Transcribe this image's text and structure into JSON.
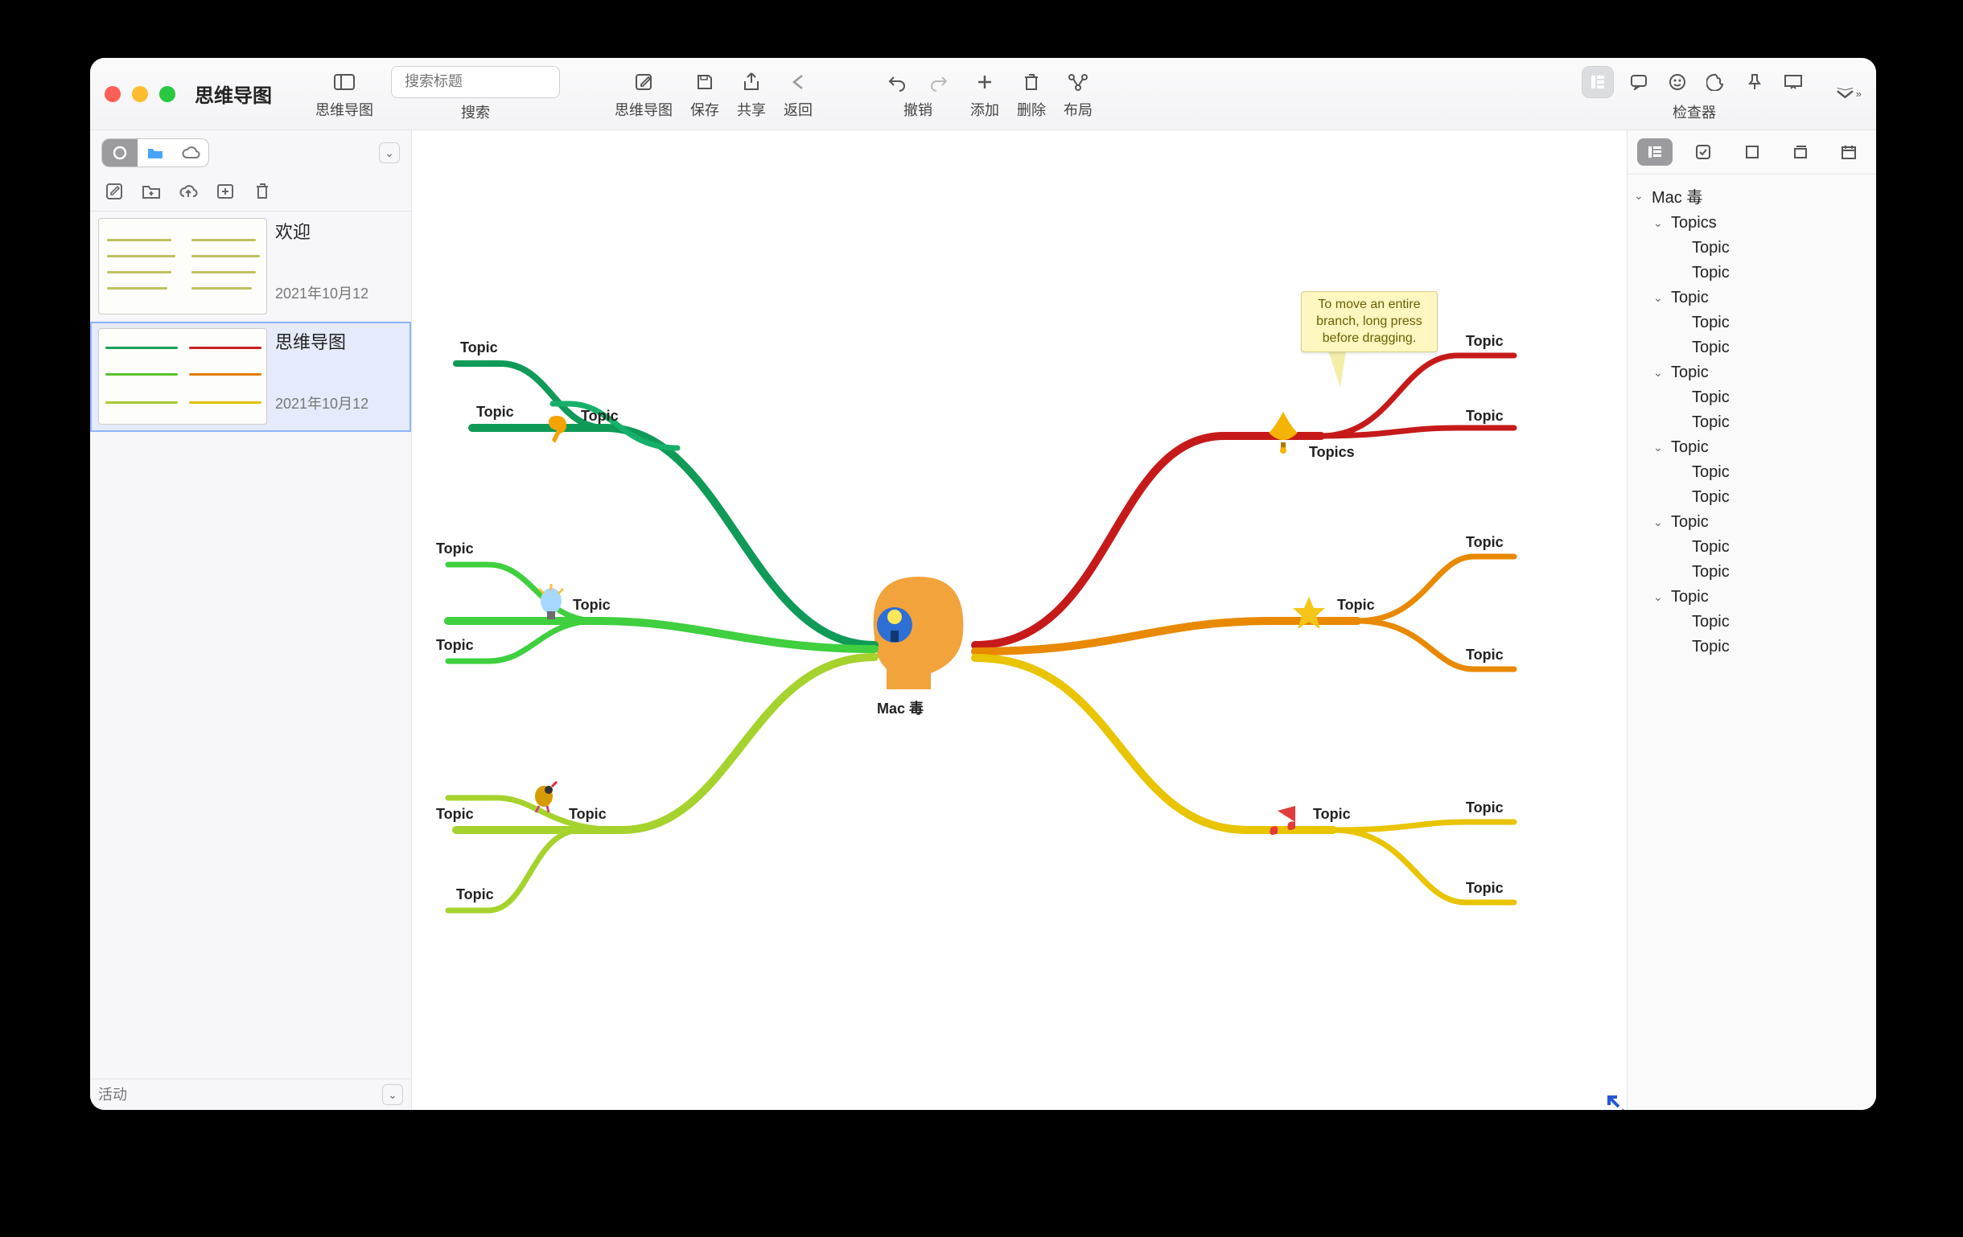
{
  "window": {
    "title": "思维导图"
  },
  "toolbar": {
    "mindmap_label": "思维导图",
    "search_label": "搜索",
    "search_placeholder": "搜索标题",
    "mindmap2_label": "思维导图",
    "save_label": "保存",
    "share_label": "共享",
    "back_label": "返回",
    "undo_label": "撤销",
    "add_label": "添加",
    "delete_label": "删除",
    "layout_label": "布局",
    "inspector_label": "检查器"
  },
  "sidebar": {
    "activity_placeholder": "活动",
    "docs": [
      {
        "title": "欢迎",
        "date": "2021年10月12"
      },
      {
        "title": "思维导图",
        "date": "2021年10月12"
      }
    ]
  },
  "canvas": {
    "center_label": "Mac 毒",
    "tip_text": "To move an entire branch, long press before dragging.",
    "branches": {
      "left_top_1": "Topic",
      "left_top_2": "Topic",
      "left_top_sub": "Topic",
      "left_mid_1": "Topic",
      "left_mid_sub": "Topic",
      "left_mid_2": "Topic",
      "left_bot_1": "Topic",
      "left_bot_sub": "Topic",
      "left_bot_2": "Topic",
      "right_top_main": "Topics",
      "right_top_1": "Topic",
      "right_top_2": "Topic",
      "right_mid1_main": "Topic",
      "right_mid1_1": "Topic",
      "right_mid1_2": "Topic",
      "right_bot_main": "Topic",
      "right_bot_1": "Topic",
      "right_bot_2": "Topic"
    }
  },
  "outline": {
    "root": "Mac 毒",
    "topics_label": "Topics",
    "topic_label": "Topic"
  }
}
